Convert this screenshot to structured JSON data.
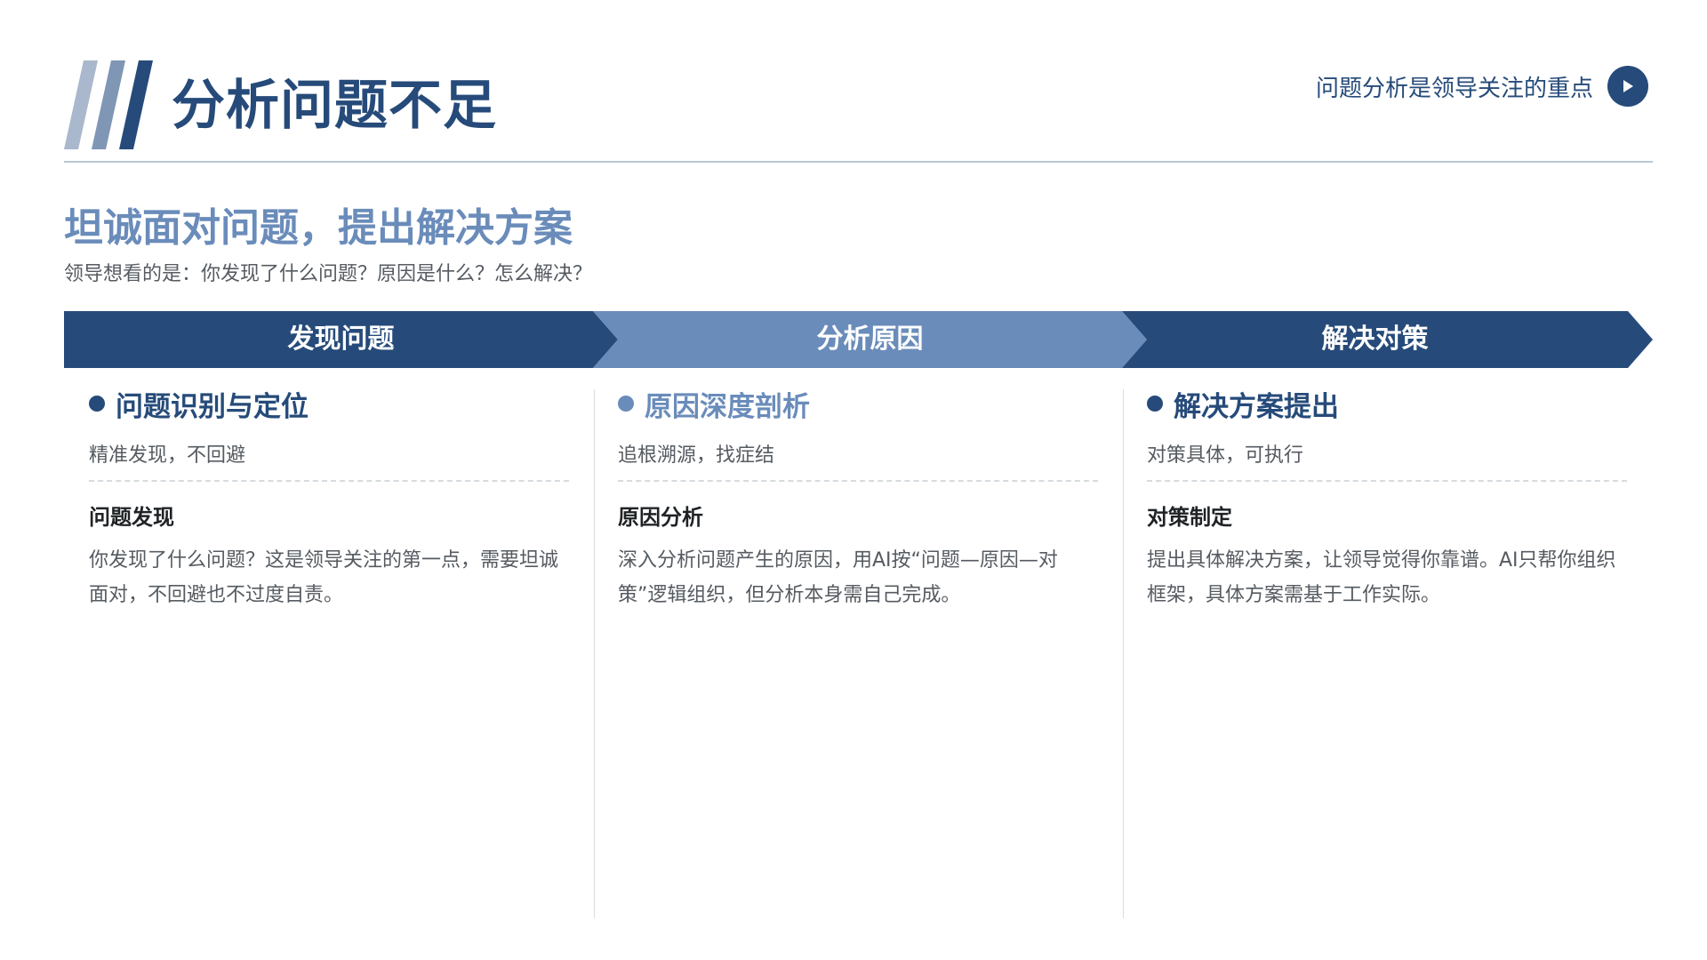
{
  "header": {
    "title": "分析问题不足",
    "note": "问题分析是领导关注的重点"
  },
  "section": {
    "subtitle": "坦诚面对问题，提出解决方案",
    "intro": "领导想看的是：你发现了什么问题？原因是什么？怎么解决？"
  },
  "steps": [
    {
      "label": "发现问题",
      "color": "#264b7a"
    },
    {
      "label": "分析原因",
      "color": "#6a8cba"
    },
    {
      "label": "解决对策",
      "color": "#264b7a"
    }
  ],
  "columns": [
    {
      "heading": "问题识别与定位",
      "heading_color": "#264b7a",
      "tagline": "精准发现，不回避",
      "subhead": "问题发现",
      "body": "你发现了什么问题？这是领导关注的第一点，需要坦诚面对，不回避也不过度自责。"
    },
    {
      "heading": "原因深度剖析",
      "heading_color": "#6a8cba",
      "tagline": "追根溯源，找症结",
      "subhead": "原因分析",
      "body": "深入分析问题产生的原因，用AI按“问题—原因—对策”逻辑组织，但分析本身需自己完成。"
    },
    {
      "heading": "解决方案提出",
      "heading_color": "#264b7a",
      "tagline": "对策具体，可执行",
      "subhead": "对策制定",
      "body": "提出具体解决方案，让领导觉得你靠谱。AI只帮你组织框架，具体方案需基于工作实际。"
    }
  ],
  "colors": {
    "primary": "#264b7a",
    "accent": "#6a8cba",
    "stripe_light": "#a9b8cc",
    "stripe_mid": "#7f96b4"
  },
  "icons": {
    "note_button": "play-icon"
  }
}
